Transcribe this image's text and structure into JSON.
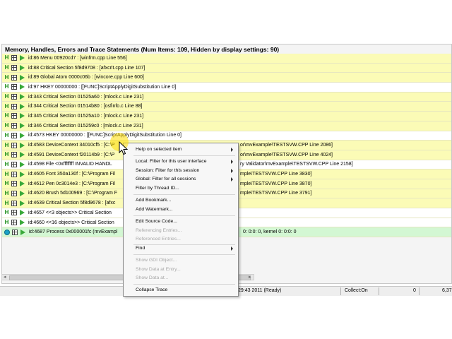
{
  "panel": {
    "title": "Memory, Handles, Errors and Trace Statements (Num Items: 109, Hidden by display settings: 90)"
  },
  "rows": [
    {
      "text": "id:86 Menu 00920cd7 : [winfrm.cpp Line 556]",
      "right": ""
    },
    {
      "text": "id:88 Critical Section 5f8d9708 : [afxcrit.cpp Line 107]",
      "right": ""
    },
    {
      "text": "id:89 Global Atom 0000c06b : [wincore.cpp Line 600]",
      "right": ""
    },
    {
      "text": "id:97 HKEY 00000000 : [[FUNC]ScriptApplyDigitSubstitution Line 0]",
      "right": ""
    },
    {
      "text": "id:343 Critical Section 01525a60 : [mlock.c Line 231]",
      "right": ""
    },
    {
      "text": "id:344 Critical Section 01514b80 : [osfinfo.c Line 88]",
      "right": ""
    },
    {
      "text": "id:345 Critical Section 01525a10 : [mlock.c Line 231]",
      "right": ""
    },
    {
      "text": "id:346 Critical Section 015259c0 : [mlock.c Line 231]",
      "right": ""
    },
    {
      "text": "id:4573 HKEY 00000000 : [[FUNC]ScriptApplyDigitSubstitution Line 0]",
      "right": ""
    },
    {
      "text": "id:4583 DeviceContext 34010cf5 : [C:\\P",
      "right": "or\\mvExample\\TESTSVW.CPP Line 2086]"
    },
    {
      "text": "id:4591 DeviceContext f20114b9 : [C:\\P",
      "right": "or\\mvExample\\TESTSVW.CPP Line 4024]"
    },
    {
      "text": "id:4598 File <0xffffffff INVALID HANDL",
      "right": "ry Validator\\mvExample\\TESTSVW.CPP Line 2158]"
    },
    {
      "text": "id:4605 Font 350a130f : [C:\\Program Fil",
      "right": "mple\\TESTSVW.CPP Line 3830]"
    },
    {
      "text": "id:4612 Pen 0c3014e3 : [C:\\Program Fil",
      "right": "mple\\TESTSVW.CPP Line 3870]"
    },
    {
      "text": "id:4620 Brush 5d100969 : [C:\\Program F",
      "right": "mple\\TESTSVW.CPP Line 3791]"
    },
    {
      "text": "id:4639 Critical Section 5f8d9678 : [afxc",
      "right": ""
    },
    {
      "text": "id:4657 <<3 objects>> Critical Section",
      "right": ""
    },
    {
      "text": "id:4660 <<16 objects>> Critical Section",
      "right": ""
    },
    {
      "text": "id:4687 Process 0x000001fc (mvExampl",
      "right": "0: 0:0: 0, kernel 0: 0:0: 0"
    }
  ],
  "statusbar": {
    "time": "29:43 2011 (Ready)",
    "collect": "Collect:On",
    "count": "0",
    "total": "6,37"
  },
  "context_menu": {
    "items": [
      {
        "label": "Help on selected item",
        "disabled": false,
        "submenu": true
      },
      {
        "label": "Local: Filter for this user interface",
        "disabled": false,
        "submenu": true
      },
      {
        "label": "Session: Filter for this session",
        "disabled": false,
        "submenu": true
      },
      {
        "label": "Global: Filter for all sessions",
        "disabled": false,
        "submenu": true
      },
      {
        "label": "Filter by Thread ID...",
        "disabled": false,
        "submenu": false
      },
      {
        "label": "Add Bookmark...",
        "disabled": false,
        "submenu": false
      },
      {
        "label": "Add Watermark...",
        "disabled": false,
        "submenu": false
      },
      {
        "label": "Edit Source Code...",
        "disabled": false,
        "submenu": false
      },
      {
        "label": "Referencing Entries...",
        "disabled": true,
        "submenu": false
      },
      {
        "label": "Referenced Entries...",
        "disabled": true,
        "submenu": false
      },
      {
        "label": "Find",
        "disabled": false,
        "submenu": true
      },
      {
        "label": "Show GDI Object...",
        "disabled": true,
        "submenu": false
      },
      {
        "label": "Show Data at Entry...",
        "disabled": true,
        "submenu": false
      },
      {
        "label": "Show Data at...",
        "disabled": true,
        "submenu": false
      },
      {
        "label": "Collapse Trace",
        "disabled": false,
        "submenu": false
      }
    ]
  }
}
